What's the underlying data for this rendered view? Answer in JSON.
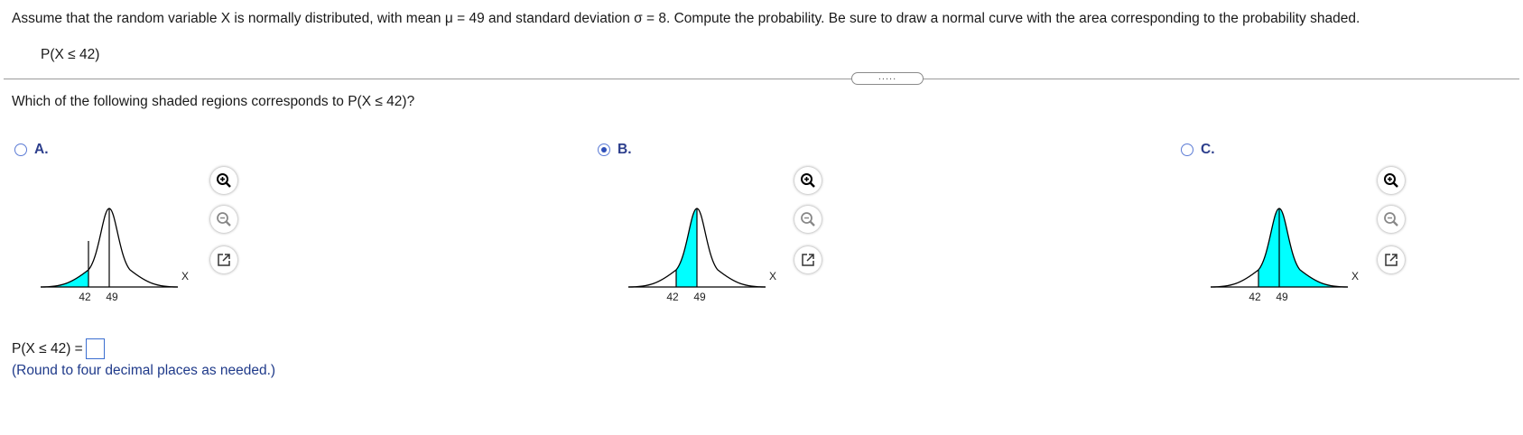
{
  "problem": {
    "prompt": "Assume that the random variable X is normally distributed, with mean μ = 49 and standard deviation σ = 8. Compute the probability. Be sure to draw a normal curve with the area corresponding to the probability shaded.",
    "expression": "P(X ≤ 42)"
  },
  "expander": {
    "label": "....."
  },
  "question": "Which of the following shaded regions corresponds to P(X ≤ 42)?",
  "options": [
    {
      "label": "A.",
      "selected": false,
      "shading": "left-tail",
      "tick_left": "42",
      "tick_right": "49",
      "axis_label": "X"
    },
    {
      "label": "B.",
      "selected": true,
      "shading": "between",
      "tick_left": "42",
      "tick_right": "49",
      "axis_label": "X"
    },
    {
      "label": "C.",
      "selected": false,
      "shading": "right-of-42",
      "tick_left": "42",
      "tick_right": "49",
      "axis_label": "X"
    }
  ],
  "controls": {
    "zoom_in": "zoom-in-icon",
    "zoom_out": "zoom-out-icon",
    "popout": "popout-icon"
  },
  "answer": {
    "prefix": "P(X ≤ 42) =",
    "value": "",
    "hint": "(Round to four decimal places as needed.)"
  },
  "colors": {
    "shade": "#00ffff",
    "accent": "#2e4fb8",
    "curve": "#000000"
  }
}
